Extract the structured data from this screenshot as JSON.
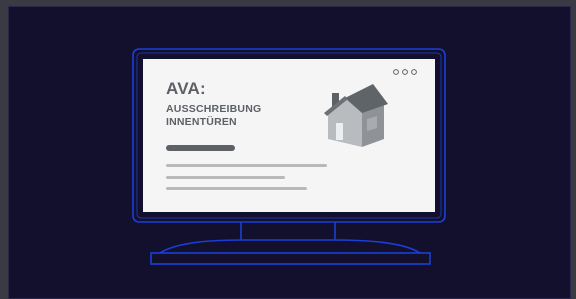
{
  "content": {
    "title": "AVA:",
    "subtitle_line1": "AUSSCHREIBUNG",
    "subtitle_line2": "INNENTÜREN"
  },
  "icons": {
    "house": "house-icon",
    "dots": "more-dots-icon"
  },
  "colors": {
    "background": "#13102e",
    "monitor_outline": "#1b3fd6",
    "screen": "#f5f5f5",
    "text": "#5d6166"
  }
}
